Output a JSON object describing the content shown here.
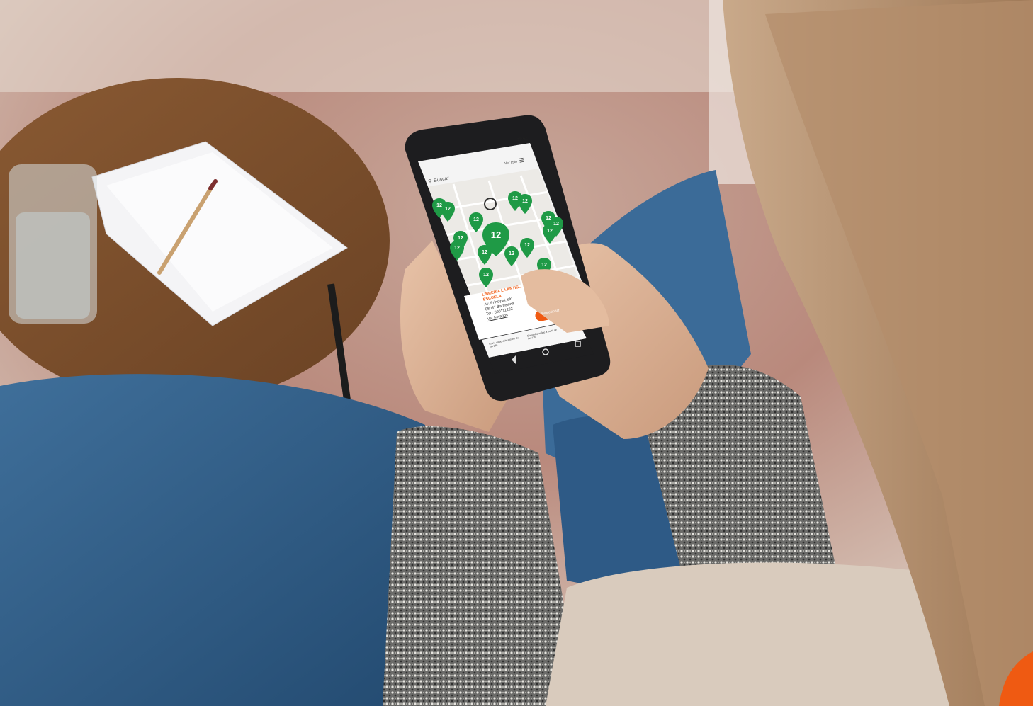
{
  "scene": {
    "description_colors": {
      "map_pin": "#1f9a46",
      "accent_orange": "#f05a12",
      "phone_body": "#1d1d1f"
    }
  },
  "phone": {
    "status_time": "11:52",
    "search_label": "Buscar",
    "view_list_label": "Ver lista",
    "map": {
      "pins": [
        {
          "label": "12"
        },
        {
          "label": "12"
        },
        {
          "label": "12"
        },
        {
          "label": "12"
        },
        {
          "label": "12"
        },
        {
          "label": "12"
        },
        {
          "label": "12"
        },
        {
          "label": "12"
        },
        {
          "label": "12"
        },
        {
          "label": "12"
        },
        {
          "label": "12"
        },
        {
          "label": "12"
        },
        {
          "label": "12"
        },
        {
          "label": "12"
        },
        {
          "label": "12"
        },
        {
          "label": "12"
        }
      ]
    },
    "card": {
      "title_line1": "LIBRERIA LA ANTIG...",
      "title_line2": "ESCUELA",
      "address_line1": "Av. Principal, s/n",
      "address_line2": "08037 Barcelona",
      "phone_line": "Tel.: 600111222",
      "link": "Ver horarios",
      "button": "Seleccionar"
    },
    "legend": {
      "item1": "Envío disponible a partir de las 18h",
      "item2": "Envío disponible a partir de las 12h"
    }
  }
}
